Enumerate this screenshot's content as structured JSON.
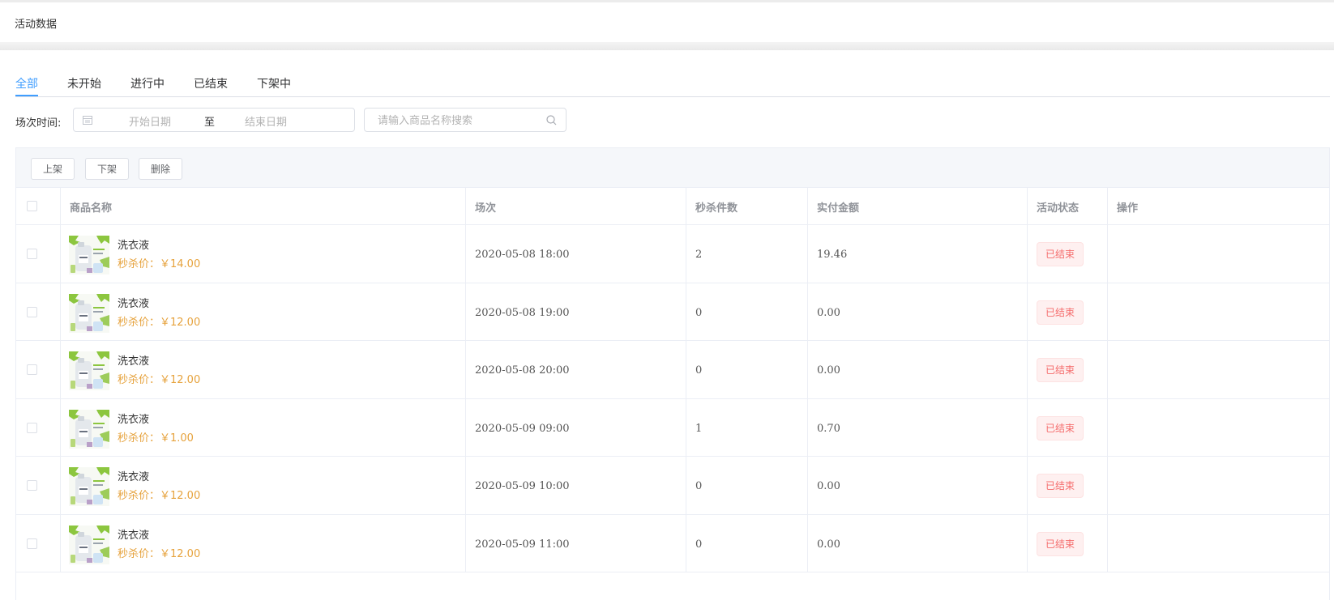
{
  "header": {
    "title": "活动数据"
  },
  "tabs": [
    {
      "label": "全部",
      "active": true
    },
    {
      "label": "未开始",
      "active": false
    },
    {
      "label": "进行中",
      "active": false
    },
    {
      "label": "已结束",
      "active": false
    },
    {
      "label": "下架中",
      "active": false
    }
  ],
  "filter": {
    "label": "场次时间:",
    "start_placeholder": "开始日期",
    "separator": "至",
    "end_placeholder": "结束日期",
    "search_placeholder": "请输入商品名称搜索"
  },
  "toolbar": {
    "buttons": [
      "上架",
      "下架",
      "删除"
    ]
  },
  "table": {
    "columns": [
      "商品名称",
      "场次",
      "秒杀件数",
      "实付金额",
      "活动状态",
      "操作"
    ],
    "rows": [
      {
        "name": "洗衣液",
        "price": "秒杀价：￥14.00",
        "session": "2020-05-08 18:00",
        "count": "2",
        "paid": "19.46",
        "status": "已结束"
      },
      {
        "name": "洗衣液",
        "price": "秒杀价：￥12.00",
        "session": "2020-05-08 19:00",
        "count": "0",
        "paid": "0.00",
        "status": "已结束"
      },
      {
        "name": "洗衣液",
        "price": "秒杀价：￥12.00",
        "session": "2020-05-08 20:00",
        "count": "0",
        "paid": "0.00",
        "status": "已结束"
      },
      {
        "name": "洗衣液",
        "price": "秒杀价：￥1.00",
        "session": "2020-05-09 09:00",
        "count": "1",
        "paid": "0.70",
        "status": "已结束"
      },
      {
        "name": "洗衣液",
        "price": "秒杀价：￥12.00",
        "session": "2020-05-09 10:00",
        "count": "0",
        "paid": "0.00",
        "status": "已结束"
      },
      {
        "name": "洗衣液",
        "price": "秒杀价：￥12.00",
        "session": "2020-05-09 11:00",
        "count": "0",
        "paid": "0.00",
        "status": "已结束"
      }
    ]
  },
  "colors": {
    "accent": "#409eff",
    "price": "#e6a23c",
    "status_ended": "#f56c6c"
  }
}
